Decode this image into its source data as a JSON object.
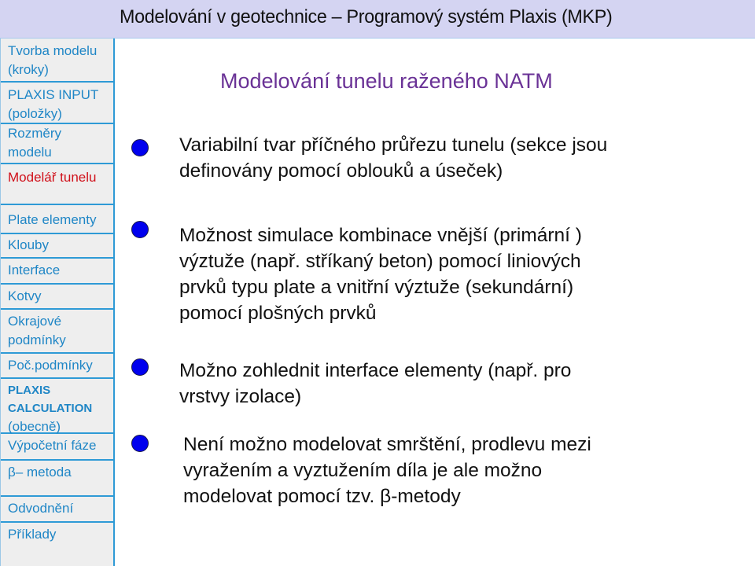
{
  "header": {
    "title": "Modelování v geotechnice – Programový systém Plaxis (MKP)",
    "background": "#d4d4f2"
  },
  "sidebar": {
    "link_color": "#1f86c6",
    "active_color": "#d0101a",
    "items": [
      {
        "label": "Tvorba modelu\n(kroky)"
      },
      {
        "label": "PLAXIS INPUT\n(položky)"
      },
      {
        "label": "Rozměry\nmodelu"
      },
      {
        "label": "Modelář tunelu",
        "active": true
      },
      {
        "label": "Plate elementy"
      },
      {
        "label": "Klouby"
      },
      {
        "label": "Interface"
      },
      {
        "label": "Kotvy"
      },
      {
        "label": "Okrajové\npodmínky"
      },
      {
        "label": "Poč.podmínky"
      },
      {
        "label_bold": "PLAXIS\nCALCULATION",
        "label_sub": "(obecně)"
      },
      {
        "label": "Výpočetní fáze"
      },
      {
        "label": "β– metoda"
      },
      {
        "label": "Odvodnění"
      },
      {
        "label": "Příklady"
      }
    ]
  },
  "main": {
    "title": "Modelování tunelu raženého NATM",
    "title_color": "#6a3296",
    "bullet_color": "#0000ee",
    "bullets": [
      {
        "text": "Variabilní tvar příčného průřezu tunelu (sekce jsou\ndefinovány pomocí oblouků a úseček)"
      },
      {
        "text": "Možnost simulace kombinace vnější (primární )\nvýztuže (např. stříkaný beton) pomocí liniových\nprvků typu plate a vnitřní výztuže (sekundární)\npomocí plošných prvků"
      },
      {
        "text": "Možno zohlednit interface elementy (např. pro\nvrstvy izolace)"
      },
      {
        "text": "Není možno modelovat smrštění, prodlevu mezi\nvyražením a vyztužením díla je ale možno\nmodelovat pomocí tzv. β-metody"
      }
    ]
  }
}
